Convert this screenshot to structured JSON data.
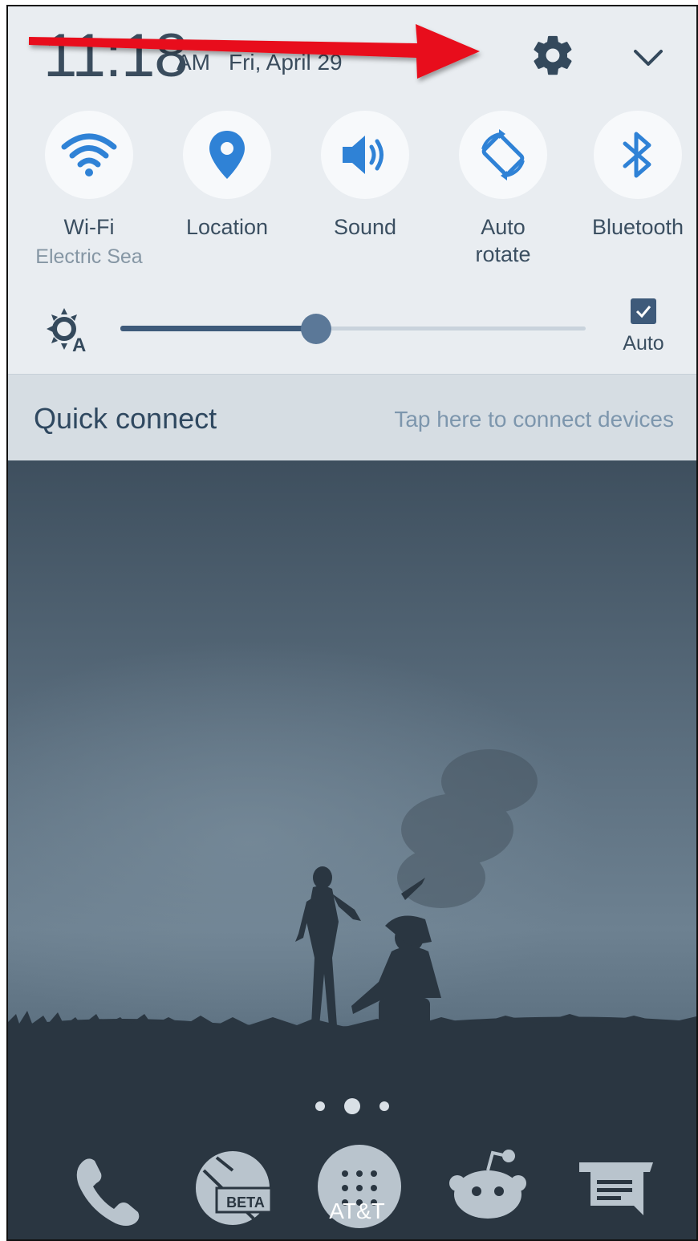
{
  "status": {
    "time": "11:18",
    "ampm": "AM",
    "date": "Fri, April 29"
  },
  "toggles": [
    {
      "label": "Wi-Fi",
      "sub": "Electric Sea",
      "icon": "wifi-icon"
    },
    {
      "label": "Location",
      "sub": "",
      "icon": "location-pin-icon"
    },
    {
      "label": "Sound",
      "sub": "",
      "icon": "speaker-icon"
    },
    {
      "label": "Auto\nrotate",
      "sub": "",
      "icon": "auto-rotate-icon"
    },
    {
      "label": "Bluetooth",
      "sub": "",
      "icon": "bluetooth-icon"
    }
  ],
  "brightness": {
    "level_fraction": 0.42,
    "auto_label": "Auto",
    "auto_checked": true
  },
  "quick_connect": {
    "title": "Quick connect",
    "hint": "Tap here to connect devices"
  },
  "dock": {
    "apps": [
      "phone-icon",
      "beta-browser-icon",
      "app-drawer-icon",
      "reddit-icon",
      "messages-icon"
    ],
    "beta_badge": "BETA",
    "carrier": "AT&T"
  },
  "colors": {
    "panel_bg": "#e9edf1",
    "accent_blue": "#2f82d6",
    "annotation_arrow": "#e8101a",
    "wallpaper_sky": "#5f7282"
  }
}
